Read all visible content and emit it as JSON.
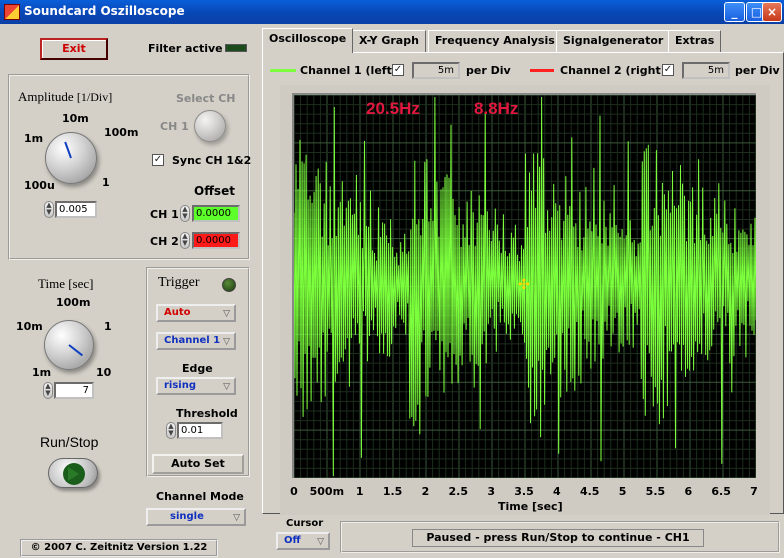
{
  "window": {
    "title": "Soundcard Oszilloscope"
  },
  "left": {
    "exit_label": "Exit",
    "filter_label": "Filter active",
    "amplitude": {
      "title": "Amplitude",
      "unit": "[1/Div]",
      "scale_labels": [
        "10m",
        "1m",
        "100m",
        "100u",
        "1"
      ],
      "value": "0.005"
    },
    "select_ch": {
      "label": "Select CH",
      "ch_label": "CH 1"
    },
    "sync_label": "Sync CH 1&2",
    "offset": {
      "title": "Offset",
      "ch1_label": "CH 1",
      "ch1_value": "0.0000",
      "ch2_label": "CH 2",
      "ch2_value": "0.0000"
    },
    "time": {
      "title": "Time [sec]",
      "scale_labels": [
        "100m",
        "10m",
        "1",
        "1m",
        "10"
      ],
      "value": "7"
    },
    "trigger": {
      "title": "Trigger",
      "mode": "Auto",
      "channel": "Channel 1",
      "edge_label": "Edge",
      "edge": "rising",
      "threshold_label": "Threshold",
      "threshold": "0.01",
      "autoset_label": "Auto Set"
    },
    "runstop_label": "Run/Stop",
    "channel_mode": {
      "label": "Channel Mode",
      "value": "single"
    },
    "copyright": "© 2007  C. Zeitnitz Version 1.22"
  },
  "tabs": [
    "Oscilloscope",
    "X-Y Graph",
    "Frequency Analysis",
    "Signalgenerator",
    "Extras"
  ],
  "channels": {
    "ch1_label": "Channel 1 (left)",
    "ch1_div": "5m",
    "ch2_label": "Channel 2 (right)",
    "ch2_div": "5m",
    "per_div": "per Div"
  },
  "plot": {
    "freq1": "20.5Hz",
    "freq2": "8.8Hz",
    "xticks": [
      "0",
      "500m",
      "1",
      "1.5",
      "2",
      "2.5",
      "3",
      "3.5",
      "4",
      "4.5",
      "5",
      "5.5",
      "6",
      "6.5",
      "7"
    ],
    "xlabel": "Time [sec]"
  },
  "cursor": {
    "label": "Cursor",
    "value": "Off"
  },
  "status": "Paused - press Run/Stop to continue - CH1",
  "colors": {
    "ch1": "#7cff3c",
    "ch2": "#ff2020",
    "accent_red": "#d00000"
  }
}
